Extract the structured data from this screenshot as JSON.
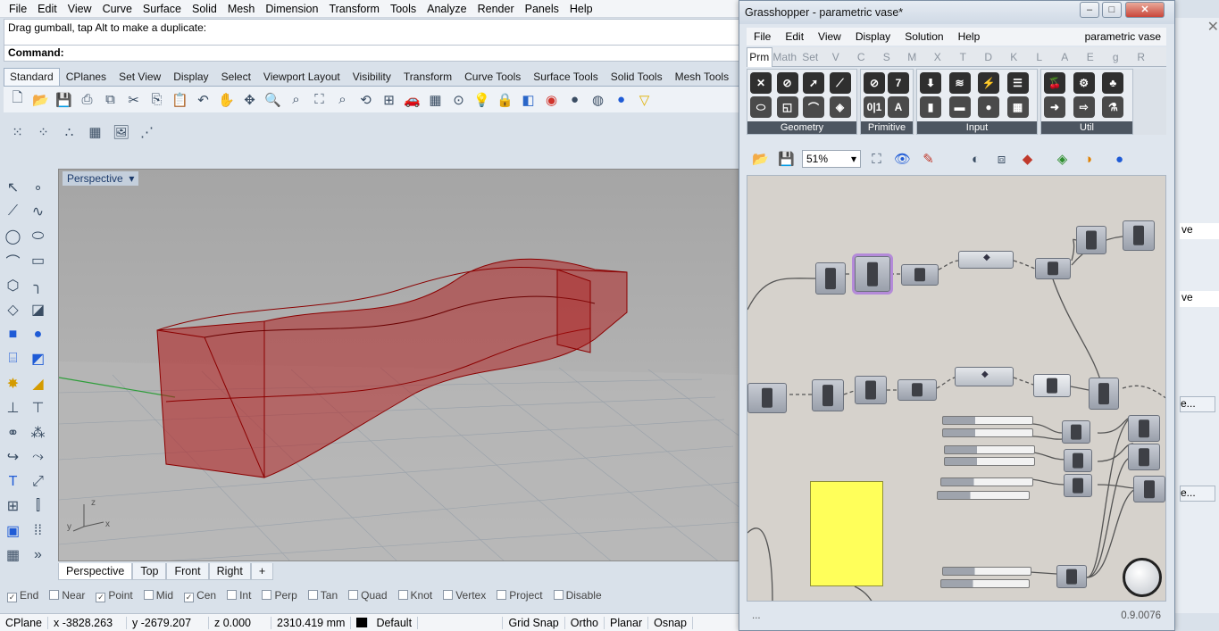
{
  "rhino": {
    "menu": [
      "File",
      "Edit",
      "View",
      "Curve",
      "Surface",
      "Solid",
      "Mesh",
      "Dimension",
      "Transform",
      "Tools",
      "Analyze",
      "Render",
      "Panels",
      "Help"
    ],
    "command_history": "Drag gumball, tap Alt to make a duplicate:",
    "command_prompt": "Command:",
    "toolbar_tabs": [
      "Standard",
      "CPlanes",
      "Set View",
      "Display",
      "Select",
      "Viewport Layout",
      "Visibility",
      "Transform",
      "Curve Tools",
      "Surface Tools",
      "Solid Tools",
      "Mesh Tools"
    ],
    "active_tab": "Standard",
    "viewport_label": "Perspective",
    "viewport_tabs": [
      "Perspective",
      "Top",
      "Front",
      "Right"
    ],
    "axis_labels": {
      "z": "z",
      "y": "y",
      "x": "x"
    },
    "osnaps": [
      {
        "label": "End",
        "checked": true
      },
      {
        "label": "Near",
        "checked": false
      },
      {
        "label": "Point",
        "checked": true
      },
      {
        "label": "Mid",
        "checked": false
      },
      {
        "label": "Cen",
        "checked": true
      },
      {
        "label": "Int",
        "checked": false
      },
      {
        "label": "Perp",
        "checked": false
      },
      {
        "label": "Tan",
        "checked": false
      },
      {
        "label": "Quad",
        "checked": false
      },
      {
        "label": "Knot",
        "checked": false
      },
      {
        "label": "Vertex",
        "checked": false
      },
      {
        "label": "Project",
        "checked": false
      },
      {
        "label": "Disable",
        "checked": false
      }
    ],
    "status": {
      "cplane": "CPlane",
      "x": "x -3828.263",
      "y": "y -2679.207",
      "z": "z 0.000",
      "units": "2310.419 mm",
      "layer": "Default",
      "grid_snap": "Grid Snap",
      "ortho": "Ortho",
      "planar": "Planar",
      "osnap": "Osnap"
    },
    "right_panel_fragments": [
      "ve",
      "ve",
      "e...",
      "e..."
    ]
  },
  "grasshopper": {
    "title": "Grasshopper - parametric vase*",
    "menu": [
      "File",
      "Edit",
      "View",
      "Display",
      "Solution",
      "Help"
    ],
    "document_name": "parametric vase",
    "category_tabs": [
      "Prm",
      "Math",
      "Set",
      "V",
      "C",
      "S",
      "M",
      "X",
      "T",
      "D",
      "K",
      "L",
      "A",
      "E",
      "g",
      "R"
    ],
    "active_category": "Prm",
    "groups": [
      {
        "label": "Geometry",
        "icons": [
          "✕",
          "⬭",
          "⊘",
          "◱",
          "➚",
          "⌒",
          "⟋",
          "◈"
        ]
      },
      {
        "label": "Primitive",
        "icons": [
          "⊘",
          "0|1",
          "7",
          "A"
        ]
      },
      {
        "label": "Input",
        "icons": [
          "⬇",
          "▮",
          "≋",
          "▬",
          "⚡",
          "●",
          "☰",
          "▦"
        ]
      },
      {
        "label": "Util",
        "icons": [
          "🍒",
          "➜",
          "⚙",
          "⇨",
          "♣",
          "⚗"
        ]
      }
    ],
    "zoom": "51%",
    "version": "0.9.0076",
    "status_left": "..."
  }
}
